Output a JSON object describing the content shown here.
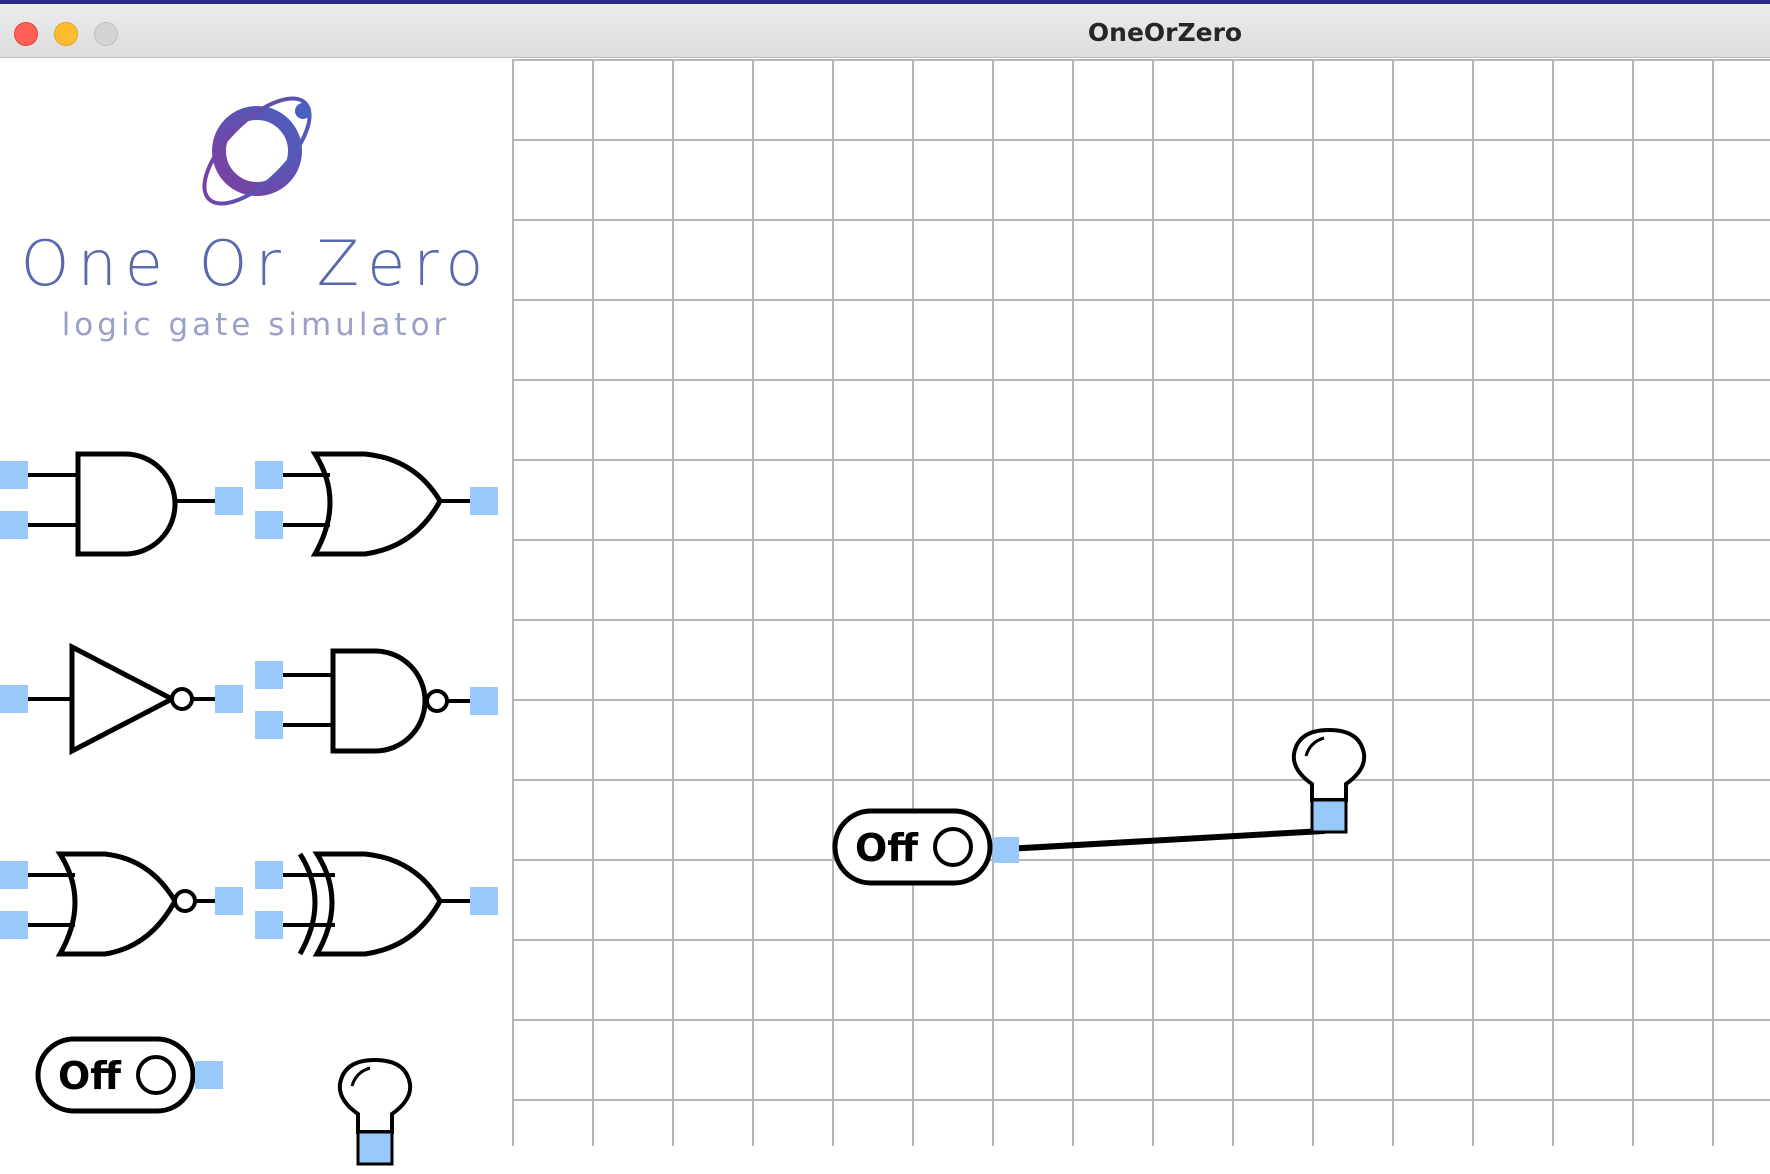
{
  "window": {
    "title": "OneOrZero"
  },
  "brand": {
    "name": "One Or Zero",
    "tagline": "logic gate simulator"
  },
  "palette": {
    "items": [
      "and-gate",
      "or-gate",
      "not-gate",
      "nand-gate",
      "nor-gate",
      "xor-gate",
      "switch",
      "light-bulb"
    ],
    "switch_label": "Off"
  },
  "canvas": {
    "switch_label": "Off",
    "wire": "switch-output to bulb-input"
  },
  "colors": {
    "connector": "#99c9fb",
    "grid": "#b5b5b5",
    "brand_text": "#5a68ad",
    "tagline_text": "#9aa0c8",
    "logo_gradient_start": "#7b3fa0",
    "logo_gradient_end": "#4a5fbf"
  }
}
